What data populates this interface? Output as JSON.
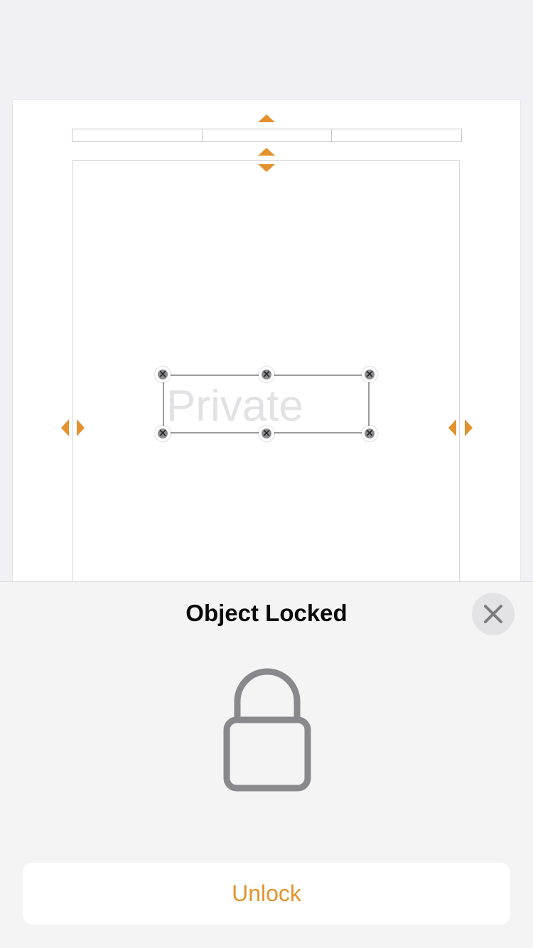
{
  "document": {
    "watermark_text": "Private"
  },
  "sheet": {
    "title": "Object Locked",
    "unlock_label": "Unlock",
    "close_icon": "close-icon",
    "lock_icon": "lock-icon"
  },
  "colors": {
    "accent": "#e3922f",
    "handle": "#8c8c90",
    "sheet_background": "#f4f4f5"
  }
}
